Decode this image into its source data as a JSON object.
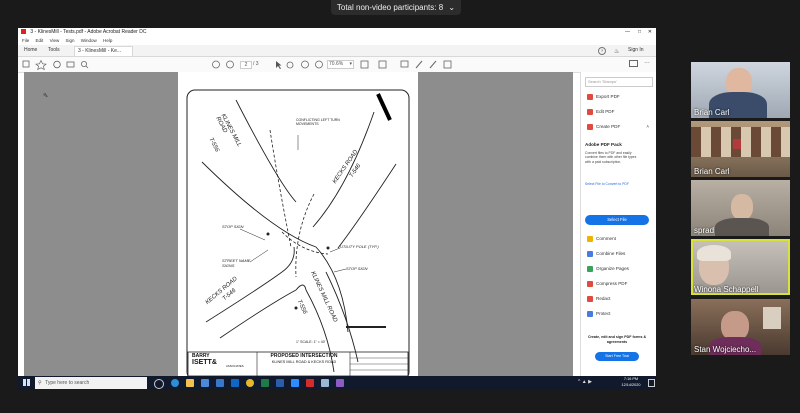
{
  "banner": {
    "label": "Total non-video participants: 8",
    "chevron": "chevron-down-icon"
  },
  "window": {
    "title": "3 - KlinesMill - Tests.pdf - Adobe Acrobat Reader DC"
  },
  "menu": [
    "File",
    "Edit",
    "View",
    "Sign",
    "Window",
    "Help"
  ],
  "tabs": {
    "home": "Home",
    "tools": "Tools",
    "doc": "3 - KlinesMill - Ke..."
  },
  "toolbar": {
    "page": "2",
    "of": "/ 3",
    "zoom": "70.6%",
    "sign_in": "Sign In"
  },
  "pane": {
    "search_placeholder": "Search 'Stamps'",
    "items_top": [
      {
        "label": "Export PDF",
        "color": "#e04a3f"
      },
      {
        "label": "Edit PDF",
        "color": "#e04a3f"
      },
      {
        "label": "Create PDF",
        "color": "#e04a3f"
      }
    ],
    "promo_title": "Adobe PDF Pack",
    "promo_text": "Convert files to PDF and easily combine them with other file types with a paid subscription.",
    "promo_link": "Select File to Convert to PDF",
    "select_button": "Select File",
    "items_bottom": [
      {
        "label": "Comment",
        "color": "#f0b400"
      },
      {
        "label": "Combine Files",
        "color": "#4a7be0"
      },
      {
        "label": "Organize Pages",
        "color": "#3aa35a"
      },
      {
        "label": "Compress PDF",
        "color": "#e04a3f"
      },
      {
        "label": "Redact",
        "color": "#e04a3f"
      },
      {
        "label": "Protect",
        "color": "#4a7be0"
      }
    ],
    "footer_text": "Create, edit and sign PDF forms & agreements",
    "trial_button": "Start Free Trial"
  },
  "drawing": {
    "road1": "KLINES MILL ROAD T-556",
    "road1_top": "KLINES MILL\nROAD",
    "t556": "T-556",
    "road2": "KECKS ROAD",
    "t546": "T-546",
    "road2_bottom": "KECKS ROAD",
    "t546b": "T-546",
    "road1_bottom": "KLINES MILL ROAD",
    "t556b": "T-556",
    "note1": "CONFLICTING LEFT TURN MOVEMENTS",
    "stop1": "STOP SIGN",
    "street_signs": "STREET NAME SIGNS",
    "utility": "UTILITY POLE (TYP.)",
    "stop2": "STOP SIGN",
    "scale": "1\" SCALE: 1\" = 40'",
    "title_main": "PROPOSED INTERSECTION",
    "title_sub": "KLINES MILL ROAD & KECKS ROAD",
    "logo1": "BARRY",
    "logo2": "ISETT&",
    "logo3": "ASSOCIATES"
  },
  "taskbar": {
    "search": "Type here to search",
    "time": "7:16 PM",
    "date": "12/14/2020"
  },
  "participants": [
    {
      "name": "Brian Carl"
    },
    {
      "name": "Brian Carl"
    },
    {
      "name": "sprad"
    },
    {
      "name": "Winona Schappell"
    },
    {
      "name": "Stan Wojciecho..."
    }
  ]
}
